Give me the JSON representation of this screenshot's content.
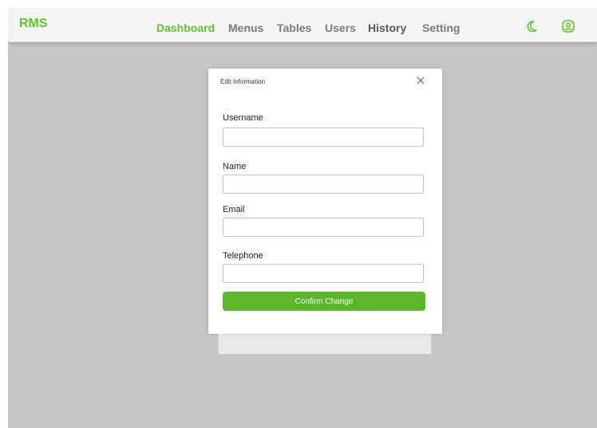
{
  "header": {
    "logo": "RMS",
    "nav": [
      {
        "label": "Dashboard"
      },
      {
        "label": "Menus"
      },
      {
        "label": "Tables"
      },
      {
        "label": "Users"
      },
      {
        "label": "History"
      },
      {
        "label": "Setting"
      }
    ],
    "icons": [
      "moon-icon",
      "user-profile-icon"
    ]
  },
  "modal": {
    "title": "Edit Information",
    "fields": [
      {
        "label": "Username",
        "value": "",
        "placeholder": ""
      },
      {
        "label": "Name",
        "value": "",
        "placeholder": ""
      },
      {
        "label": "Email",
        "value": "",
        "placeholder": ""
      },
      {
        "label": "Telephone",
        "value": "",
        "placeholder": ""
      }
    ],
    "confirm_label": "Confirm Change"
  },
  "colors": {
    "accent": "#5ec52a",
    "button": "#5ab828",
    "backdrop": "#c6c6c6"
  }
}
